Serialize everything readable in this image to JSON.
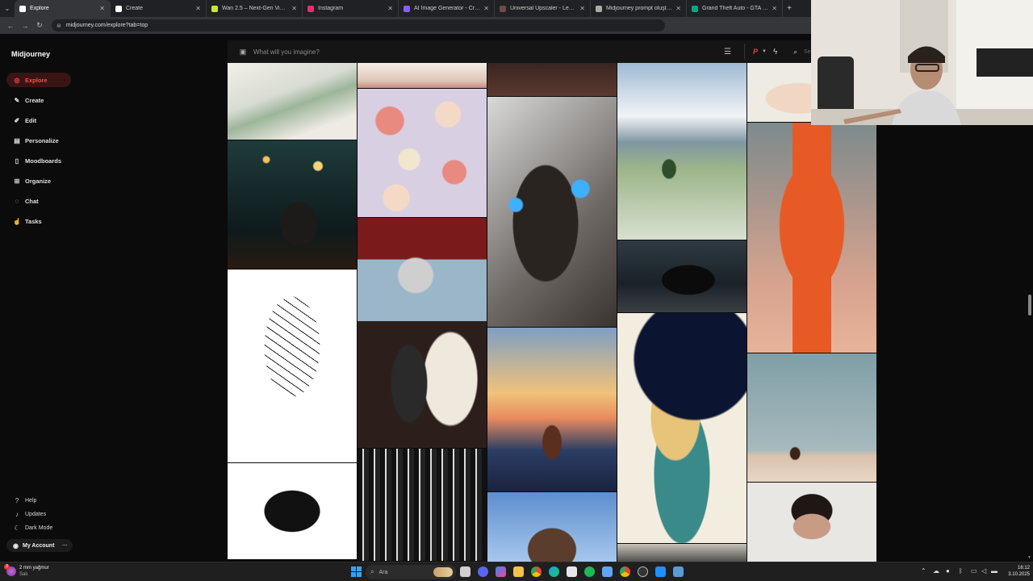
{
  "browser": {
    "tabs": [
      {
        "title": "Explore",
        "active": true,
        "color": "#ffffff"
      },
      {
        "title": "Create",
        "active": false,
        "color": "#ffffff"
      },
      {
        "title": "Wan 2.5 – Next-Gen Video Mo",
        "active": false,
        "color": "#c8e43c"
      },
      {
        "title": "Instagram",
        "active": false,
        "color": "#e1306c"
      },
      {
        "title": "AI Image Generator - Create A",
        "active": false,
        "color": "#8b5cf6"
      },
      {
        "title": "Universal Upscaler - Leonardo.",
        "active": false,
        "color": "#6d4c41"
      },
      {
        "title": "Midjourney prompt oluşturma",
        "active": false,
        "color": "#aaaaaa"
      },
      {
        "title": "Grand Theft Auto - GTA Foot G",
        "active": false,
        "color": "#10a37f"
      }
    ],
    "url": "midjourney.com/explore?tab=top"
  },
  "sidebar": {
    "brand": "Midjourney",
    "nav": [
      {
        "label": "Explore",
        "icon": "compass-icon",
        "active": true
      },
      {
        "label": "Create",
        "icon": "brush-icon",
        "active": false
      },
      {
        "label": "Edit",
        "icon": "edit-icon",
        "active": false
      },
      {
        "label": "Personalize",
        "icon": "sliders-icon",
        "active": false
      },
      {
        "label": "Moodboards",
        "icon": "moodboard-icon",
        "active": false
      },
      {
        "label": "Organize",
        "icon": "grid-icon",
        "active": false
      },
      {
        "label": "Chat",
        "icon": "chat-icon",
        "active": false
      },
      {
        "label": "Tasks",
        "icon": "thumbs-up-icon",
        "active": false
      }
    ],
    "bottom": [
      {
        "label": "Help",
        "icon": "help-icon"
      },
      {
        "label": "Updates",
        "icon": "bell-icon"
      },
      {
        "label": "Dark Mode",
        "icon": "moon-icon"
      }
    ],
    "account": "My Account"
  },
  "search": {
    "placeholder": "What will you imagine?",
    "partial_text": "Se"
  },
  "gallery": {
    "columns": [
      [
        {
          "subject": "green leaf on marble"
        },
        {
          "subject": "woman in city bokeh at night"
        },
        {
          "subject": "line drawing of kissing couple"
        },
        {
          "subject": "demon head emblem"
        }
      ],
      [
        {
          "subject": "sandals on table"
        },
        {
          "subject": "floral pattern on lavender"
        },
        {
          "subject": "couple in red gondola with disco ball"
        },
        {
          "subject": "black and white gothic town pattern"
        }
      ],
      [
        {
          "subject": "dark fabric"
        },
        {
          "subject": "siamese cat with blue eyes"
        },
        {
          "subject": "sailing ship at sunset painting"
        },
        {
          "subject": "man with sunglasses and skyscraper"
        }
      ],
      [
        {
          "subject": "mountain meadow with tree"
        },
        {
          "subject": "black sports car in the rain"
        },
        {
          "subject": "ornate lion illustration"
        },
        {
          "subject": "dark object"
        }
      ],
      [
        {
          "subject": "portrait close-up"
        },
        {
          "subject": "orange spaceship"
        },
        {
          "subject": "horse rider on salt flat"
        },
        {
          "subject": "young man portrait"
        }
      ]
    ]
  },
  "taskbar": {
    "weather_temp": "2 mm yağmur",
    "weather_day": "Salı",
    "search_label": "Ara",
    "time": "16:12",
    "date": "3.10.2025"
  }
}
